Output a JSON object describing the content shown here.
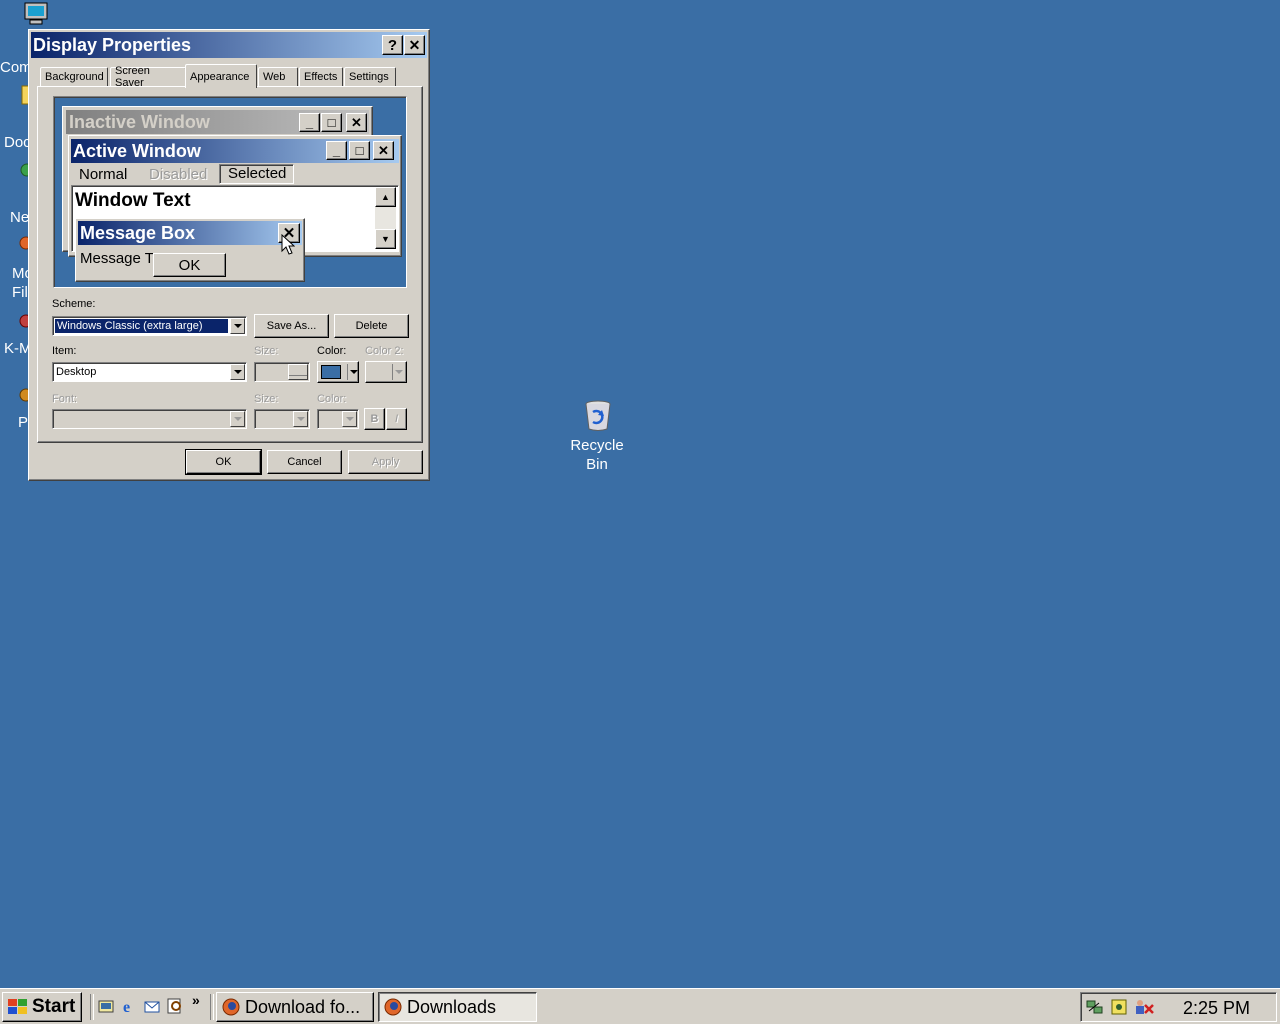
{
  "desktop": {
    "left_icon_labels": [
      "Com",
      "Doc",
      "Ne",
      "Mo",
      "Fil",
      "K-M",
      "P"
    ],
    "recycle_bin_label_line1": "Recycle",
    "recycle_bin_label_line2": "Bin"
  },
  "dialog": {
    "title": "Display Properties",
    "help_label": "?",
    "close_label": "✕",
    "tabs": [
      "Background",
      "Screen Saver",
      "Appearance",
      "Web",
      "Effects",
      "Settings"
    ],
    "active_tab": "Appearance",
    "preview": {
      "inactive_title": "Inactive Window",
      "active_title": "Active Window",
      "menu_normal": "Normal",
      "menu_disabled": "Disabled",
      "menu_selected": "Selected",
      "window_text": "Window Text",
      "msgbox_title": "Message Box",
      "msgbox_text": "Message T",
      "msgbox_ok": "OK"
    },
    "scheme_label": "Scheme:",
    "scheme_value": "Windows Classic (extra large)",
    "save_as_label": "Save As...",
    "delete_label": "Delete",
    "item_label": "Item:",
    "item_value": "Desktop",
    "size_label": "Size:",
    "color_label": "Color:",
    "color2_label": "Color 2:",
    "font_label": "Font:",
    "font_size_label": "Size:",
    "font_color_label": "Color:",
    "bold_label": "B",
    "italic_label": "I",
    "ok_label": "OK",
    "cancel_label": "Cancel",
    "apply_label": "Apply",
    "item_color": "#3a6ea5"
  },
  "taskbar": {
    "start_label": "Start",
    "chevron": "»",
    "tasks": [
      "Download fo...",
      "Downloads"
    ],
    "clock": "2:25 PM"
  },
  "colors": {
    "desktop": "#3a6ea5",
    "title_active": "#0a246a",
    "title_inactive": "#808080",
    "face": "#d4d0c8"
  }
}
